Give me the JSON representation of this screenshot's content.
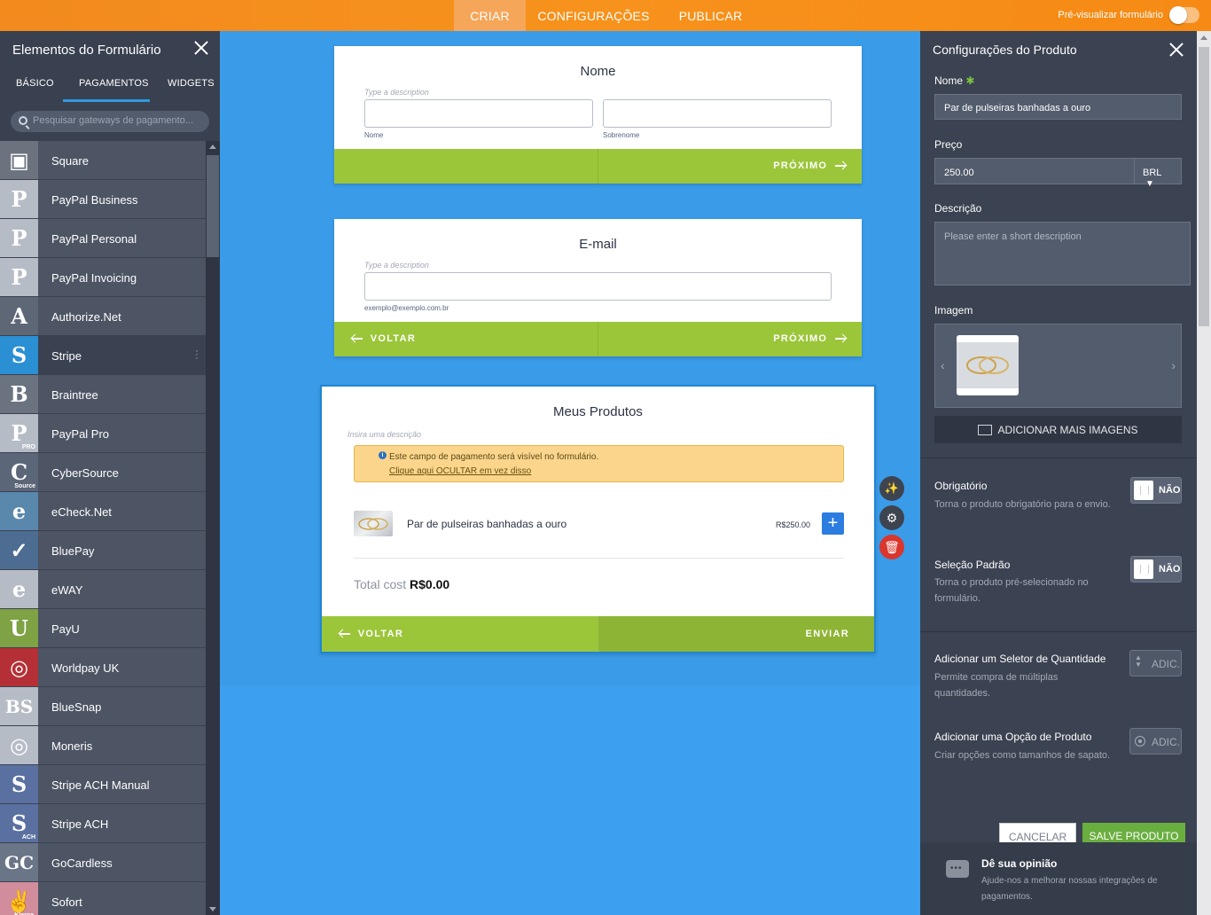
{
  "topbar": {
    "tabs": [
      "CRIAR",
      "CONFIGURAÇÕES",
      "PUBLICAR"
    ],
    "active_tab": "CRIAR",
    "preview_label": "Pré-visualizar formulário"
  },
  "left_panel": {
    "title": "Elementos do Formulário",
    "tabs": [
      "BÁSICO",
      "PAGAMENTOS",
      "WIDGETS"
    ],
    "active_tab": "PAGAMENTOS",
    "search_placeholder": "Pesquisar gateways de pagamento...",
    "items": [
      {
        "label": "Square",
        "icon": "square-icon",
        "color": "#6c737f"
      },
      {
        "label": "PayPal Business",
        "icon": "paypal-business-icon",
        "color": "#b6bcc6"
      },
      {
        "label": "PayPal Personal",
        "icon": "paypal-personal-icon",
        "color": "#b6bcc6"
      },
      {
        "label": "PayPal Invoicing",
        "icon": "paypal-invoicing-icon",
        "color": "#b6bcc6"
      },
      {
        "label": "Authorize.Net",
        "icon": "authorize-net-icon",
        "color": "#5d6776"
      },
      {
        "label": "Stripe",
        "icon": "stripe-icon",
        "color": "#2b8fd4"
      },
      {
        "label": "Braintree",
        "icon": "braintree-icon",
        "color": "#6b7381"
      },
      {
        "label": "PayPal Pro",
        "icon": "paypal-pro-icon",
        "color": "#b6bcc6"
      },
      {
        "label": "CyberSource",
        "icon": "cybersource-icon",
        "color": "#5b6678"
      },
      {
        "label": "eCheck.Net",
        "icon": "echeck-icon",
        "color": "#5a87ac"
      },
      {
        "label": "BluePay",
        "icon": "bluepay-icon",
        "color": "#4d6c92"
      },
      {
        "label": "eWAY",
        "icon": "eway-icon",
        "color": "#b6bcc6"
      },
      {
        "label": "PayU",
        "icon": "payu-icon",
        "color": "#7ea244"
      },
      {
        "label": "Worldpay UK",
        "icon": "worldpay-icon",
        "color": "#b43036"
      },
      {
        "label": "BlueSnap",
        "icon": "bluesnap-icon",
        "color": "#b6bcc6"
      },
      {
        "label": "Moneris",
        "icon": "moneris-icon",
        "color": "#b6bcc6"
      },
      {
        "label": "Stripe ACH Manual",
        "icon": "stripe-ach-manual-icon",
        "color": "#5a70a0"
      },
      {
        "label": "Stripe ACH",
        "icon": "stripe-ach-icon",
        "color": "#5a70a0"
      },
      {
        "label": "GoCardless",
        "icon": "gocardless-icon",
        "color": "#6b7588"
      },
      {
        "label": "Sofort",
        "icon": "sofort-icon",
        "color": "#d28d9c"
      }
    ],
    "item_glyphs": [
      "▣",
      "P",
      "P",
      "P",
      "A",
      "S",
      "B",
      "P",
      "C",
      "e",
      "✓",
      "e",
      "U",
      "◎",
      "BS",
      "◎",
      "S",
      "S",
      "GC",
      "✌"
    ],
    "item_sublabels": {
      "1": "",
      "7": "PRO",
      "8": "Source",
      "17": "ACH",
      "19": "Klarna."
    }
  },
  "cards": {
    "name_card": {
      "title": "Nome",
      "description": "Type a description",
      "first_sub": "Nome",
      "last_sub": "Sobrenome",
      "next": "PRÓXIMO"
    },
    "email_card": {
      "title": "E-mail",
      "description": "Type a description",
      "sub": "exemplo@exemplo.com.br",
      "back": "VOLTAR",
      "next": "PRÓXIMO"
    },
    "products_card": {
      "title": "Meus Produtos",
      "description": "Insira uma descrição",
      "notice_text": "Este campo de pagamento será visível no formulário.",
      "notice_link": "Clique aqui OCULTAR em vez disso",
      "product_name": "Par de pulseiras banhadas a ouro",
      "product_price": "R$250.00",
      "total_label": "Total cost",
      "total_value": "R$0.00",
      "back": "VOLTAR",
      "submit": "ENVIAR"
    }
  },
  "right_panel": {
    "title": "Configurações do Produto",
    "name_label": "Nome",
    "name_value": "Par de pulseiras banhadas a ouro",
    "price_label": "Preço",
    "price_value": "250.00",
    "currency": "BRL",
    "desc_label": "Descrição",
    "desc_placeholder": "Please enter a short description",
    "image_label": "Imagem",
    "add_images": "ADICIONAR MAIS IMAGENS",
    "required_label": "Obrigatório",
    "required_desc": "Torna o produto obrigatório para o envio.",
    "required_value": "NÃO",
    "default_label": "Seleção Padrão",
    "default_desc": "Torna o produto pré-selecionado no formulário.",
    "default_value": "NÃO",
    "qty_label": "Adicionar um Seletor de Quantidade",
    "qty_desc": "Permite compra de múltiplas quantidades.",
    "qty_btn": "ADIC.",
    "opt_label": "Adicionar uma Opção de Produto",
    "opt_desc": "Criar opções como tamanhos de sapato.",
    "opt_btn": "ADIC.",
    "cancel": "CANCELAR",
    "save": "SALVE PRODUTO",
    "feedback_title": "Dê sua opinião",
    "feedback_text": "Ajude-nos a melhorar nossas integrações de pagamentos."
  }
}
